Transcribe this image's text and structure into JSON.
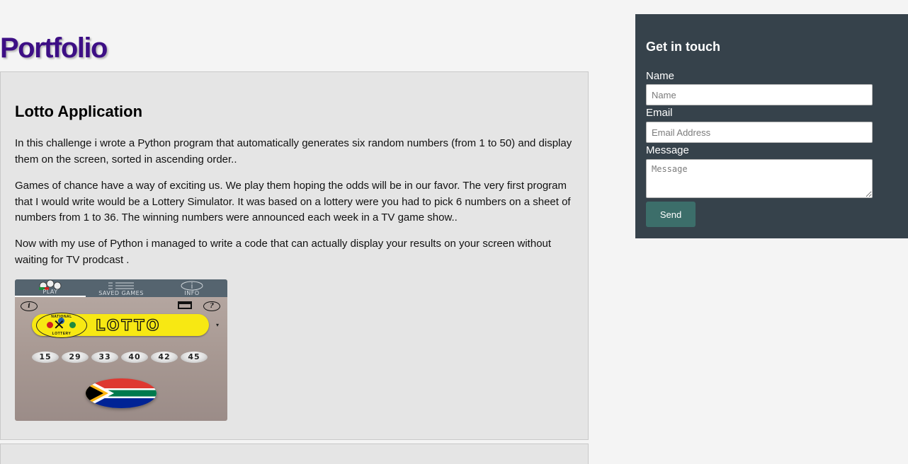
{
  "page": {
    "title": "Portfolio"
  },
  "projects": [
    {
      "title": "Lotto Application",
      "paragraphs": [
        "In this challenge i wrote a Python program that automatically generates six random numbers (from 1 to 50) and display them on the screen, sorted in ascending order..",
        "Games of chance have a way of exciting us. We play them hoping the odds will be in our favor. The very first program that I would write would be a Lottery Simulator. It was based on a lottery were you had to pick 6 numbers on a sheet of numbers from 1 to 36. The winning numbers were announced each week in a TV game show..",
        "Now with my use of Python i managed to write a code that can actually display your results on your screen without waiting for TV prodcast ."
      ],
      "screenshot": {
        "tabs": [
          "PLAY",
          "SAVED GAMES",
          "INFO"
        ],
        "active_tab": "PLAY",
        "info_glyph": "i",
        "help_glyph": "?",
        "logo_word": "LOTTO",
        "badge_top": "NATIONAL",
        "badge_bottom": "LOTTERY",
        "balls": [
          "15",
          "29",
          "33",
          "40",
          "42",
          "45"
        ],
        "icons": [
          "info-icon",
          "save-icon",
          "help-icon",
          "flag-icon"
        ]
      }
    }
  ],
  "contact": {
    "title": "Get in touch",
    "name_label": "Name",
    "name_placeholder": "Name",
    "email_label": "Email",
    "email_placeholder": "Email Address",
    "message_label": "Message",
    "message_placeholder": "Message",
    "send_label": "Send"
  },
  "colors": {
    "title": "#3d0f85",
    "card_bg": "#e5e5e5",
    "contact_bg": "#36424b",
    "send_button": "#3c6e6a",
    "page_bg": "#f4f4f4"
  }
}
